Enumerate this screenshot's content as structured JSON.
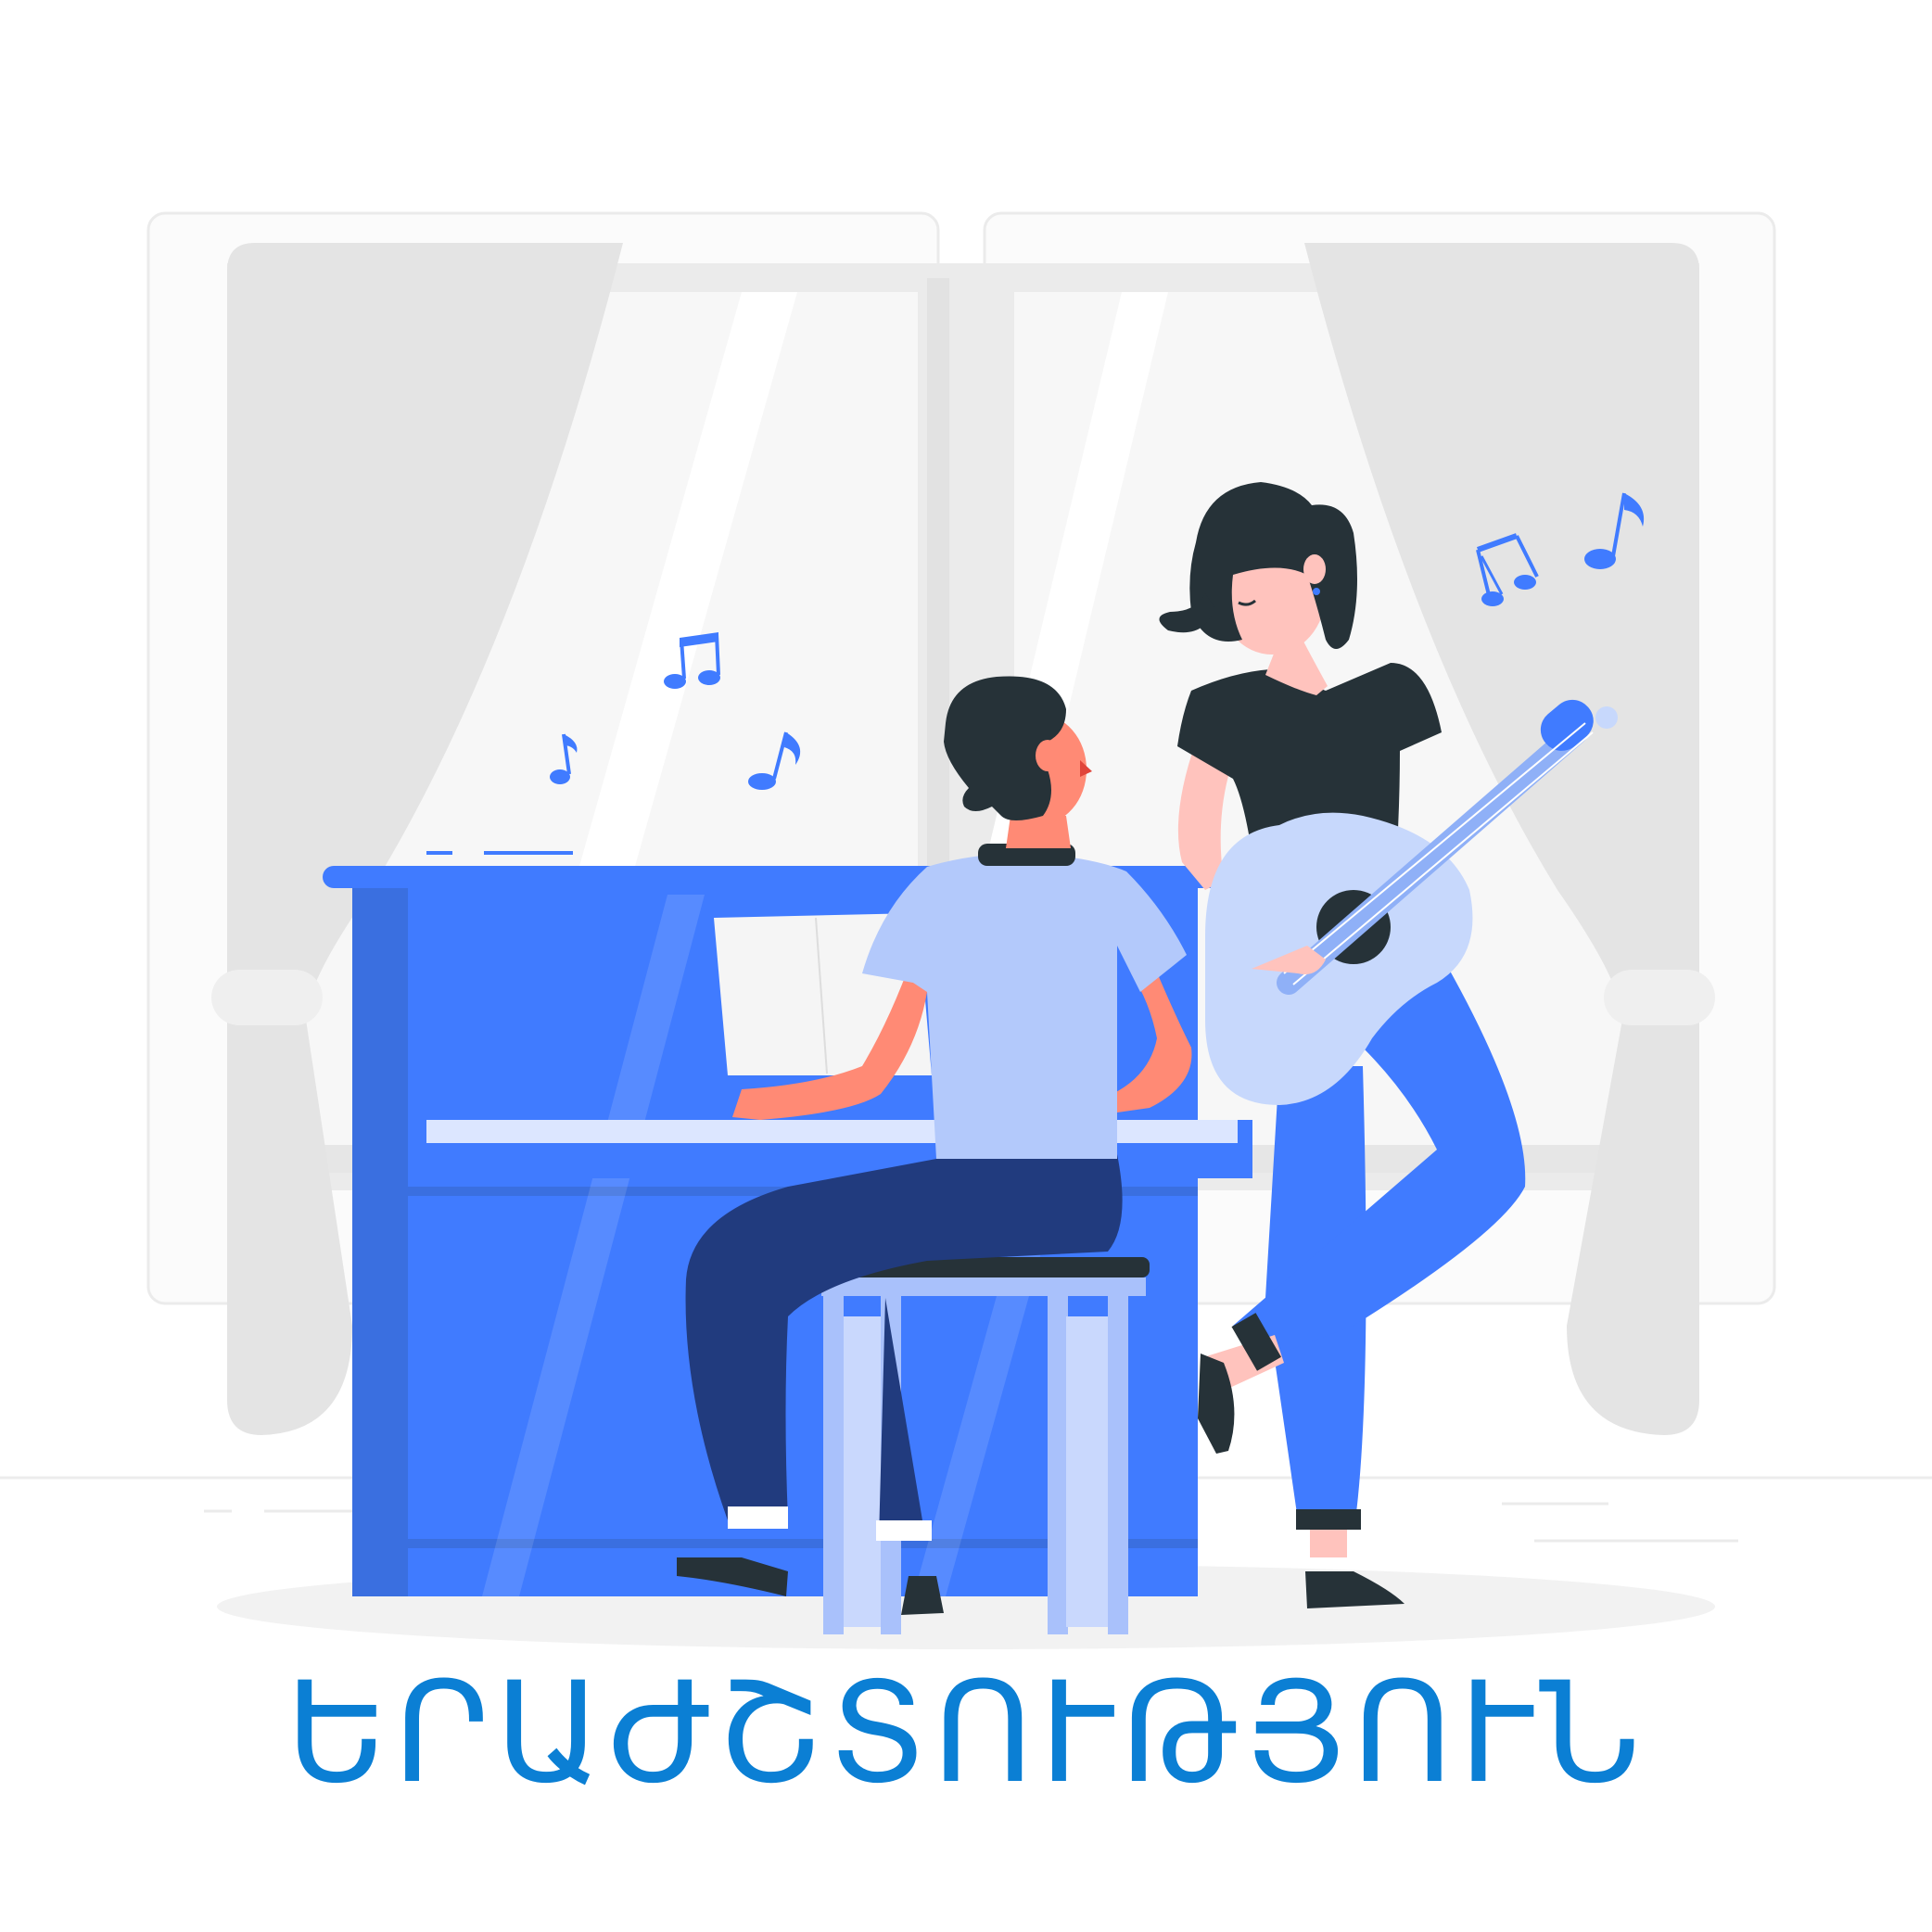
{
  "caption": {
    "text": "ԵՐԱԺՇՏՈՒԹՅՈՒՆ"
  },
  "colors": {
    "caption": "#0b7fd4",
    "window_frame": "#ebebeb",
    "window_glass": "#f7f7f7",
    "curtain": "#e4e4e4",
    "piano": "#407bff",
    "piano_shade": "#3a6fe0",
    "keys": "#dce6ff",
    "shirt_light": "#b3c9fb",
    "trousers_dark": "#213b7e",
    "hair_dark": "#263238",
    "skin_pink": "#ff8a75",
    "skin_light": "#ffc3bd",
    "guitar": "#c7d8fc",
    "jeans": "#407bff",
    "stool": "#a9c1fb",
    "note": "#407bff",
    "floor_shadow": "#f2f2f2"
  },
  "icons": [
    "music-note-icon",
    "beamed-notes-icon",
    "sixteenth-note-icon"
  ]
}
